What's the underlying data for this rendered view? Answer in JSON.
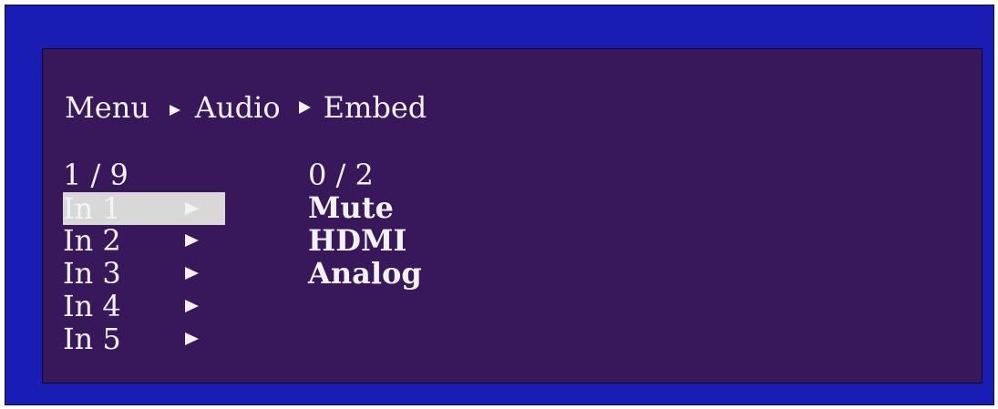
{
  "breadcrumb": {
    "items": [
      "Menu",
      "Audio",
      "Embed"
    ]
  },
  "left_list": {
    "counter": "1 / 9",
    "items": [
      {
        "label": "In 1",
        "selected": true
      },
      {
        "label": "In 2",
        "selected": false
      },
      {
        "label": "In 3",
        "selected": false
      },
      {
        "label": "In 4",
        "selected": false
      },
      {
        "label": "In 5",
        "selected": false
      }
    ]
  },
  "right_list": {
    "counter": "0 / 2",
    "items": [
      "Mute",
      "HDMI",
      "Analog"
    ]
  },
  "colors": {
    "outer_bezel": "#1a1db4",
    "screen_background": "#38185a",
    "text": "#f2f2f2",
    "selection_highlight": "#d8d8d8"
  }
}
